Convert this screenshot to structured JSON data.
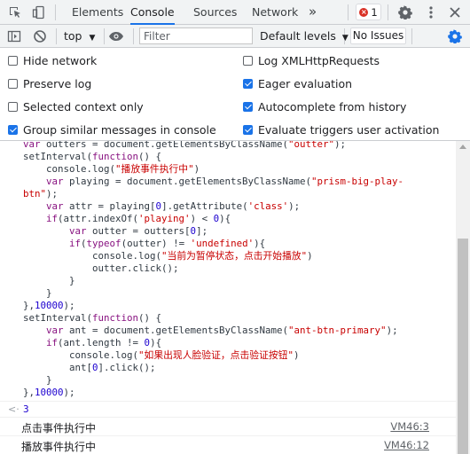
{
  "tabs": [
    "Elements",
    "Console",
    "Sources",
    "Network"
  ],
  "more_tabs": "»",
  "error_count": "1",
  "toolbar": {
    "context": "top",
    "filter_placeholder": "Filter",
    "levels": "Default levels",
    "issues": "No Issues"
  },
  "settings": {
    "left": [
      {
        "label": "Hide network",
        "checked": false
      },
      {
        "label": "Preserve log",
        "checked": false
      },
      {
        "label": "Selected context only",
        "checked": false
      },
      {
        "label": "Group similar messages in console",
        "checked": true
      }
    ],
    "right": [
      {
        "label": "Log XMLHttpRequests",
        "checked": false
      },
      {
        "label": "Eager evaluation",
        "checked": true
      },
      {
        "label": "Autocomplete from history",
        "checked": true
      },
      {
        "label": "Evaluate triggers user activation",
        "checked": true
      }
    ]
  },
  "console": {
    "result_value": "3",
    "logs": [
      {
        "message": "点击事件执行中",
        "source": "VM46:3"
      },
      {
        "message": "播放事件执行中",
        "source": "VM46:12"
      }
    ]
  },
  "colors": {
    "accent": "#1a73e8",
    "error": "#d93025",
    "keyword": "#881280",
    "string": "#c80000",
    "number": "#1c00cf"
  },
  "icons": [
    "inspect-icon",
    "device-toggle-icon",
    "error-icon",
    "gear-icon",
    "more-vert-icon",
    "close-icon",
    "sidebar-toggle-icon",
    "clear-console-icon",
    "eye-icon",
    "console-settings-icon",
    "chevron-down-icon",
    "result-arrow-icon"
  ]
}
